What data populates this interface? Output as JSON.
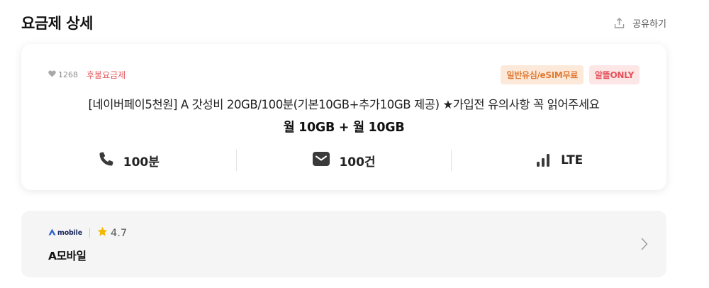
{
  "header": {
    "title": "요금제 상세",
    "share_label": "공유하기"
  },
  "plan": {
    "likes": "1268",
    "plan_type": "후불요금제",
    "badges": [
      {
        "label": "일반유심/eSIM무료",
        "color": "#e07b34"
      },
      {
        "label": "알뜰ONLY",
        "color": "#e4515a"
      }
    ],
    "name": "[네이버페이5천원] A 갓성비 20GB/100분(기본10GB+추가10GB 제공) ★가입전 유의사항 꼭 읽어주세요",
    "data": "월 10GB + 월 10GB",
    "specs": [
      {
        "icon": "phone-icon",
        "value": "100분"
      },
      {
        "icon": "message-icon",
        "value": "100건"
      },
      {
        "icon": "signal-icon",
        "value": "LTE"
      }
    ]
  },
  "carrier": {
    "logo_text": "mobile",
    "rating": "4.7",
    "name": "A모바일"
  }
}
